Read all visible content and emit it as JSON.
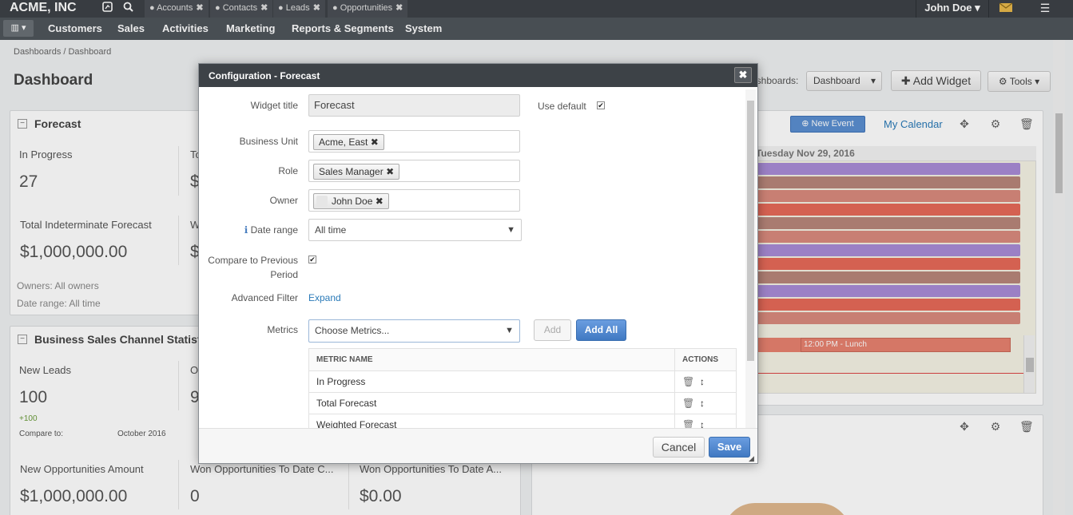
{
  "topbar": {
    "brand": "ACME, INC",
    "pinned_tabs": [
      {
        "label": "Accounts"
      },
      {
        "label": "Contacts"
      },
      {
        "label": "Leads"
      },
      {
        "label": "Opportunities"
      }
    ],
    "user_name": "John Doe"
  },
  "nav": {
    "items": [
      {
        "label": "Customers"
      },
      {
        "label": "Sales"
      },
      {
        "label": "Activities"
      },
      {
        "label": "Marketing"
      },
      {
        "label": "Reports & Segments"
      },
      {
        "label": "System"
      }
    ]
  },
  "page": {
    "breadcrumb": "Dashboards / Dashboard",
    "title": "Dashboard",
    "dashboards_label": "ashboards:",
    "dashboard_select": "Dashboard",
    "add_widget": "Add Widget",
    "tools": "Tools"
  },
  "forecast_widget": {
    "title": "Forecast",
    "in_progress_label": "In Progress",
    "in_progress_value": "27",
    "col2_label": "To",
    "col2_value": "$",
    "total_indeterminate_label": "Total Indeterminate Forecast",
    "total_indeterminate_value": "$1,000,000.00",
    "col2b_label": "W",
    "col2b_value": "$",
    "owners": "Owners: All owners",
    "date_range": "Date range: All time"
  },
  "sales_widget": {
    "title": "Business Sales Channel Statistics",
    "new_leads_label": "New Leads",
    "new_leads_value": "100",
    "new_leads_delta": "+100",
    "col2_label": "O",
    "col2_value": "9",
    "compare_label": "Compare to:",
    "compare_value": "October 2016",
    "new_opp_amount_label": "New Opportunities Amount",
    "new_opp_amount_value": "$1,000,000.00",
    "won_count_label": "Won Opportunities To Date C...",
    "won_count_value": "0",
    "won_amount_label": "Won Opportunities To Date A...",
    "won_amount_value": "$0.00"
  },
  "calendar_widget": {
    "new_event": "New Event",
    "my_calendar": "My Calendar",
    "day_header": "Tuesday Nov 29, 2016",
    "lunch_event": "12:00 PM - Lunch",
    "colors": [
      "#a98bd6",
      "#b8867a",
      "#d98a7d",
      "#e66a58",
      "#b8867a",
      "#d98a7d",
      "#a98bd6",
      "#e66a58",
      "#b8867a",
      "#a98bd6",
      "#e66a58",
      "#d98a7d"
    ]
  },
  "modal": {
    "title": "Configuration - Forecast",
    "widget_title_label": "Widget title",
    "widget_title_value": "Forecast",
    "use_default_label": "Use default",
    "business_unit_label": "Business Unit",
    "business_unit_tag": "Acme, East",
    "role_label": "Role",
    "role_tag": "Sales Manager",
    "owner_label": "Owner",
    "owner_tag": "John Doe",
    "date_range_label": "Date range",
    "date_range_value": "All time",
    "compare_label_1": "Compare to Previous",
    "compare_label_2": "Period",
    "advanced_filter_label": "Advanced Filter",
    "advanced_filter_link": "Expand",
    "metrics_label": "Metrics",
    "metrics_placeholder": "Choose Metrics...",
    "add_button": "Add",
    "add_all_button": "Add All",
    "table_headers": {
      "name": "METRIC NAME",
      "actions": "ACTIONS"
    },
    "metrics": [
      {
        "name": "In Progress"
      },
      {
        "name": "Total Forecast"
      },
      {
        "name": "Weighted Forecast"
      }
    ],
    "cancel": "Cancel",
    "save": "Save"
  },
  "colors": {
    "topbar": "#3d4247",
    "navbar": "#4f555b",
    "link": "#2a7ab8",
    "primary_button": "#4f86c6"
  }
}
